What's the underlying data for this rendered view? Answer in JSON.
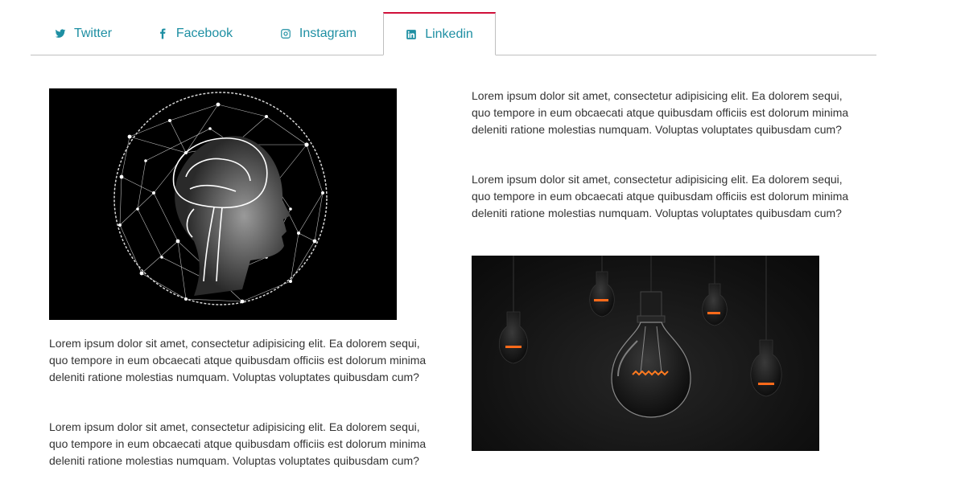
{
  "tabs": [
    {
      "label": "Twitter",
      "icon": "twitter-icon",
      "active": false
    },
    {
      "label": "Facebook",
      "icon": "facebook-icon",
      "active": false
    },
    {
      "label": "Instagram",
      "icon": "instagram-icon",
      "active": false
    },
    {
      "label": "Linkedin",
      "icon": "linkedin-icon",
      "active": true
    }
  ],
  "content": {
    "left_paragraphs": [
      "Lorem ipsum dolor sit amet, consectetur adipisicing elit. Ea dolorem sequi, quo tempore in eum obcaecati atque quibusdam officiis est dolorum minima deleniti ratione molestias numquam. Voluptas voluptates quibusdam cum?",
      "Lorem ipsum dolor sit amet, consectetur adipisicing elit. Ea dolorem sequi, quo tempore in eum obcaecati atque quibusdam officiis est dolorum minima deleniti ratione molestias numquam. Voluptas voluptates quibusdam cum?"
    ],
    "right_paragraphs": [
      "Lorem ipsum dolor sit amet, consectetur adipisicing elit. Ea dolorem sequi, quo tempore in eum obcaecati atque quibusdam officiis est dolorum minima deleniti ratione molestias numquam. Voluptas voluptates quibusdam cum?",
      "Lorem ipsum dolor sit amet, consectetur adipisicing elit. Ea dolorem sequi, quo tempore in eum obcaecati atque quibusdam officiis est dolorum minima deleniti ratione molestias numquam. Voluptas voluptates quibusdam cum?"
    ]
  },
  "colors": {
    "tab_text": "#1e8fa3",
    "active_tab_accent": "#d0103a",
    "border": "#bfbfbf",
    "body_text": "#333333"
  }
}
